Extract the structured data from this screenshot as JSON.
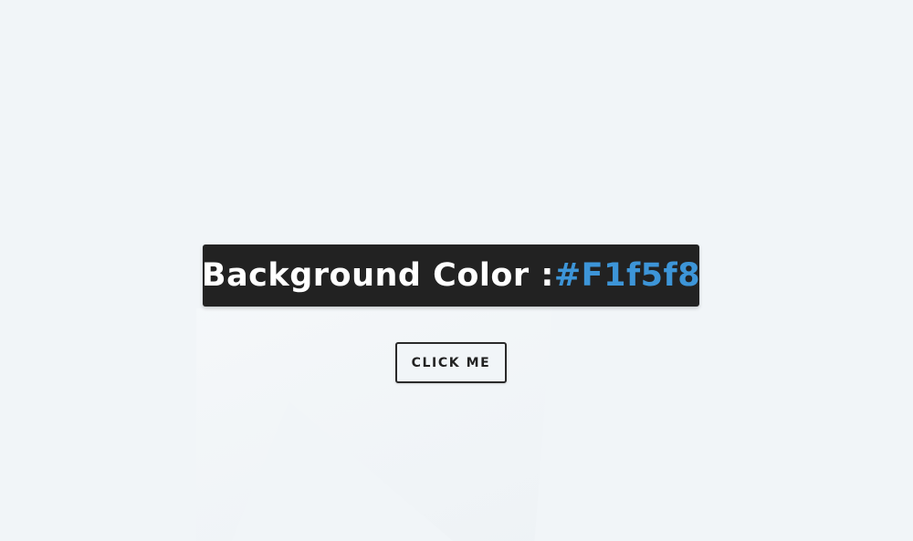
{
  "background": {
    "color": "#f1f5f8"
  },
  "label": {
    "prefix": "Background Color :",
    "hex_value": "#F1f5f8",
    "box_color": "#222222",
    "prefix_color": "#ffffff",
    "hex_color": "#3d95d8"
  },
  "button": {
    "label": "CLICK ME",
    "border_color": "#2a2a2a"
  }
}
